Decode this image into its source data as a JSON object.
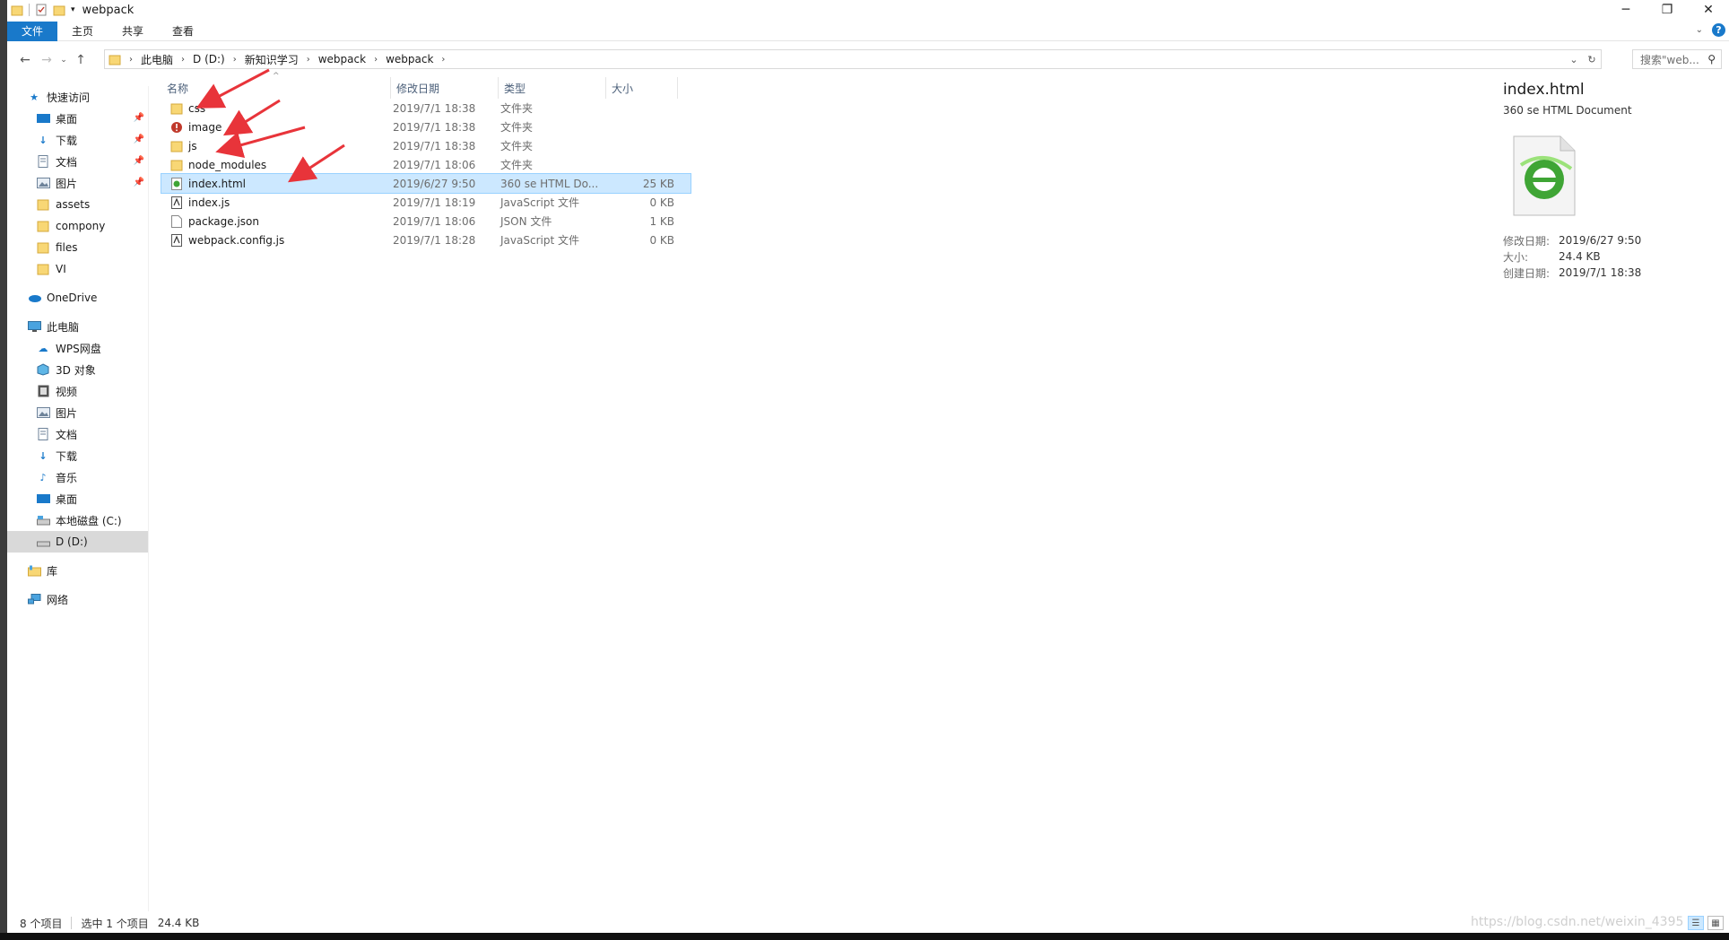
{
  "window": {
    "title": "webpack"
  },
  "ribbon": {
    "tabs": [
      "文件",
      "主页",
      "共享",
      "查看"
    ]
  },
  "address": {
    "crumbs": [
      "此电脑",
      "D (D:)",
      "新知识学习",
      "webpack",
      "webpack"
    ],
    "search_placeholder": "搜索\"web..."
  },
  "nav": {
    "quick_access": "快速访问",
    "pinned": [
      "桌面",
      "下载",
      "文档",
      "图片"
    ],
    "folders": [
      "assets",
      "compony",
      "files",
      "VI"
    ],
    "onedrive": "OneDrive",
    "this_pc": "此电脑",
    "pc_items": [
      "WPS网盘",
      "3D 对象",
      "视频",
      "图片",
      "文档",
      "下载",
      "音乐",
      "桌面",
      "本地磁盘 (C:)",
      "D (D:)"
    ],
    "library": "库",
    "network": "网络"
  },
  "columns": {
    "name": "名称",
    "date": "修改日期",
    "type": "类型",
    "size": "大小"
  },
  "files": [
    {
      "name": "css",
      "date": "2019/7/1 18:38",
      "type": "文件夹",
      "size": "",
      "icon": "folder-icon"
    },
    {
      "name": "image",
      "date": "2019/7/1 18:38",
      "type": "文件夹",
      "size": "",
      "icon": "warning-icon"
    },
    {
      "name": "js",
      "date": "2019/7/1 18:38",
      "type": "文件夹",
      "size": "",
      "icon": "folder-icon"
    },
    {
      "name": "node_modules",
      "date": "2019/7/1 18:06",
      "type": "文件夹",
      "size": "",
      "icon": "folder-icon"
    },
    {
      "name": "index.html",
      "date": "2019/6/27 9:50",
      "type": "360 se HTML Do...",
      "size": "25 KB",
      "icon": "html-file-icon"
    },
    {
      "name": "index.js",
      "date": "2019/7/1 18:19",
      "type": "JavaScript 文件",
      "size": "0 KB",
      "icon": "js-file-icon"
    },
    {
      "name": "package.json",
      "date": "2019/7/1 18:06",
      "type": "JSON 文件",
      "size": "1 KB",
      "icon": "file-icon"
    },
    {
      "name": "webpack.config.js",
      "date": "2019/7/1 18:28",
      "type": "JavaScript 文件",
      "size": "0 KB",
      "icon": "js-file-icon"
    }
  ],
  "preview": {
    "title": "index.html",
    "subtitle": "360 se HTML Document",
    "modified_label": "修改日期:",
    "modified": "2019/6/27 9:50",
    "size_label": "大小:",
    "size": "24.4 KB",
    "created_label": "创建日期:",
    "created": "2019/7/1 18:38"
  },
  "status": {
    "count": "8 个项目",
    "selected": "选中 1 个项目",
    "size": "24.4 KB"
  },
  "watermark": "https://blog.csdn.net/weixin_4395",
  "colors": {
    "accent": "#1979ca",
    "folder": "#f8d775",
    "selection": "#cce8ff",
    "arrow": "#e8343a"
  }
}
